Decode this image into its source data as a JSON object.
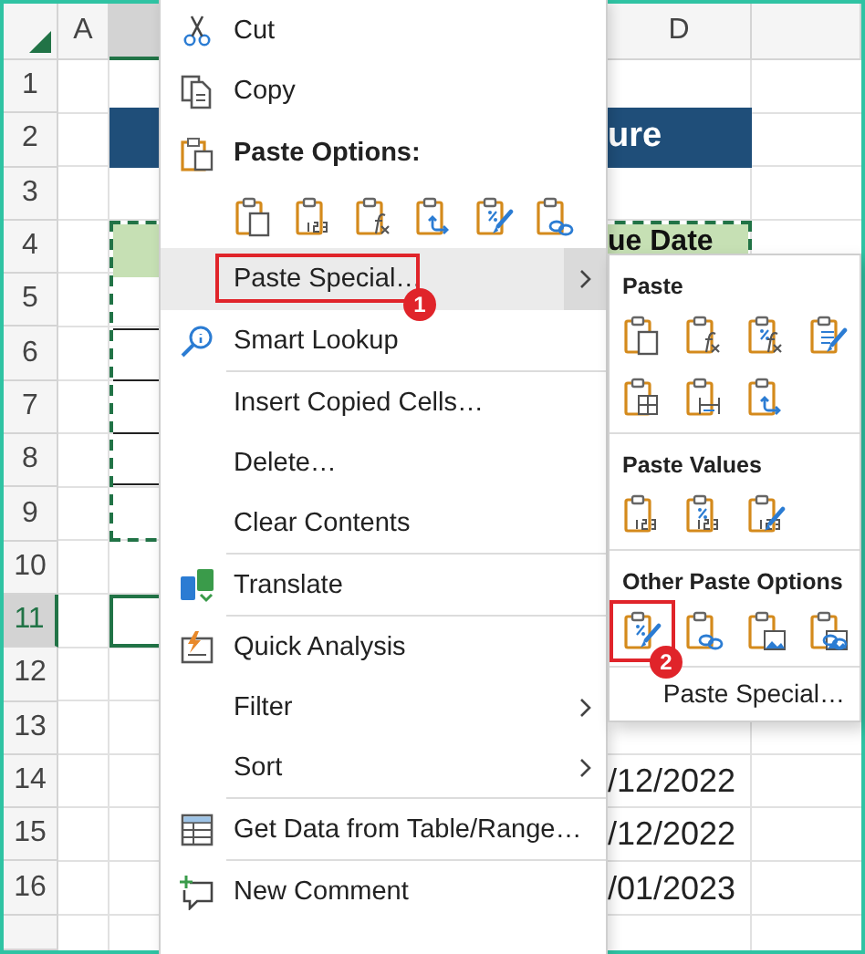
{
  "sheet": {
    "columns": [
      {
        "label": "A",
        "selected": false
      },
      {
        "selected": true
      },
      {
        "label": "D",
        "selected": false
      }
    ],
    "rows": [
      {
        "label": "1",
        "selected": false
      },
      {
        "label": "2",
        "selected": false
      },
      {
        "label": "3",
        "selected": false
      },
      {
        "label": "4",
        "selected": false
      },
      {
        "label": "5",
        "selected": false
      },
      {
        "label": "6",
        "selected": false
      },
      {
        "label": "7",
        "selected": false
      },
      {
        "label": "8",
        "selected": false
      },
      {
        "label": "9",
        "selected": false
      },
      {
        "label": "10",
        "selected": false
      },
      {
        "label": "11",
        "selected": true
      },
      {
        "label": "12",
        "selected": false
      },
      {
        "label": "13",
        "selected": false
      },
      {
        "label": "14",
        "selected": false
      },
      {
        "label": "15",
        "selected": false
      },
      {
        "label": "16",
        "selected": false
      }
    ],
    "title_cell": {
      "text": "ure"
    },
    "header_cell": {
      "text": "ue Date",
      "copied": true
    },
    "date_cells": [
      "/12/2022",
      "/12/2022",
      "/01/2023"
    ]
  },
  "context_menu": {
    "items": [
      {
        "kind": "cut",
        "label": "Cut",
        "selected": false,
        "submenu": false
      },
      {
        "kind": "copy",
        "label": "Copy",
        "selected": false,
        "submenu": false
      },
      {
        "kind": "header",
        "label": "Paste Options:"
      },
      {
        "kind": "icons",
        "icons": [
          {
            "kind": "paste"
          },
          {
            "kind": "values"
          },
          {
            "kind": "formulas"
          },
          {
            "kind": "transpose"
          },
          {
            "kind": "formatting"
          },
          {
            "kind": "link"
          }
        ]
      },
      {
        "kind": "plain",
        "label": "Paste Special…",
        "selected": true,
        "submenu": true,
        "callout": "1"
      },
      {
        "kind": "lookup",
        "label": "Smart Lookup",
        "selected": false,
        "submenu": false
      },
      {
        "kind": "separator"
      },
      {
        "kind": "plain",
        "label": "Insert Copied Cells…",
        "selected": false,
        "submenu": false
      },
      {
        "kind": "plain",
        "label": "Delete…",
        "selected": false,
        "submenu": false
      },
      {
        "kind": "plain",
        "label": "Clear Contents",
        "selected": false,
        "submenu": false
      },
      {
        "kind": "separator"
      },
      {
        "kind": "translate",
        "label": "Translate",
        "selected": false,
        "submenu": false
      },
      {
        "kind": "separator"
      },
      {
        "kind": "quick",
        "label": "Quick Analysis",
        "selected": false,
        "submenu": false
      },
      {
        "kind": "plain",
        "label": "Filter",
        "selected": false,
        "submenu": true
      },
      {
        "kind": "plain",
        "label": "Sort",
        "selected": false,
        "submenu": true
      },
      {
        "kind": "separator"
      },
      {
        "kind": "table",
        "label": "Get Data from Table/Range…",
        "selected": false,
        "submenu": false
      },
      {
        "kind": "separator"
      },
      {
        "kind": "comment",
        "label": "New Comment",
        "selected": false,
        "submenu": false
      }
    ]
  },
  "submenu": {
    "sections": [
      {
        "title": "Paste",
        "icons": [
          {
            "kind": "paste"
          },
          {
            "kind": "formulas"
          },
          {
            "kind": "formulas-number-format"
          },
          {
            "kind": "keep-source-format"
          },
          {
            "kind": "no-borders"
          },
          {
            "kind": "column-widths"
          },
          {
            "kind": "transpose"
          }
        ]
      },
      {
        "title": "Paste Values",
        "icons": [
          {
            "kind": "values"
          },
          {
            "kind": "values-number-format"
          },
          {
            "kind": "values-source-format"
          }
        ]
      },
      {
        "title": "Other Paste Options",
        "icons": [
          {
            "kind": "formatting",
            "callout": "2"
          },
          {
            "kind": "link"
          },
          {
            "kind": "picture"
          },
          {
            "kind": "linked-picture"
          }
        ]
      }
    ],
    "footer": "Paste Special…"
  }
}
